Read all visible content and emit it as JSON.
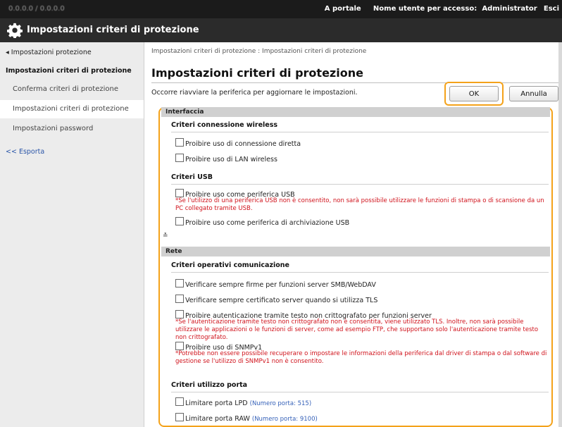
{
  "topbar": {
    "host": "0.0.0.0 / 0.0.0.0",
    "portal": "A portale",
    "user_label": "Nome utente per accesso:",
    "user_value": "Administrator",
    "logout": "Esci"
  },
  "title": "Impostazioni criteri di protezione",
  "sidebar": {
    "back": "◂ Impostazioni protezione",
    "group": "Impostazioni criteri di protezione",
    "items": [
      "Conferma criteri di protezione",
      "Impostazioni criteri di protezione",
      "Impostazioni password"
    ],
    "export": "<< Esporta"
  },
  "main": {
    "breadcrumb": "Impostazioni criteri di protezione : Impostazioni criteri di protezione",
    "heading": "Impostazioni criteri di protezione",
    "notice": "Occorre riavviare la periferica per aggiornare le impostazioni.",
    "ok": "OK",
    "cancel": "Annulla"
  },
  "interface": {
    "title": "Interfaccia",
    "wireless_head": "Criteri connessione wireless",
    "wireless_1": "Proibire uso di connessione diretta",
    "wireless_2": "Proibire uso di LAN wireless",
    "usb_head": "Criteri USB",
    "usb_1": "Proibire uso come periferica USB",
    "usb_1_note": "*Se l'utilizzo di una periferica USB non è consentito, non sarà possibile utilizzare le funzioni di stampa o di scansione da un PC collegato tramite USB.",
    "usb_2": "Proibire uso come periferica di archiviazione USB"
  },
  "rete": {
    "title": "Rete",
    "comm_head": "Criteri operativi comunicazione",
    "comm_1": "Verificare sempre firme per funzioni server SMB/WebDAV",
    "comm_2": "Verificare sempre certificato server quando si utilizza TLS",
    "comm_3": "Proibire autenticazione tramite testo non crittografato per funzioni server",
    "comm_3_note": "*Se l'autenticazione tramite testo non crittografato non è consentita, viene utilizzato TLS. Inoltre, non sarà possibile utilizzare le applicazioni o le funzioni di server, come ad esempio FTP, che supportano solo l'autenticazione tramite testo non crittografato.",
    "comm_4": "Proibire uso di SNMPv1",
    "comm_4_note": "*Potrebbe non essere possibile recuperare o impostare le informazioni della periferica dal driver di stampa o dal software di gestione se l'utilizzo di SNMPv1 non è consentito.",
    "port_head": "Criteri utilizzo porta",
    "port_1": "Limitare porta LPD",
    "port_1_num": "(Numero porta: 515)",
    "port_2": "Limitare porta RAW",
    "port_2_num": "(Numero porta: 9100)"
  },
  "colors": {
    "highlight": "#f4a21a",
    "warning": "#d0121b"
  }
}
